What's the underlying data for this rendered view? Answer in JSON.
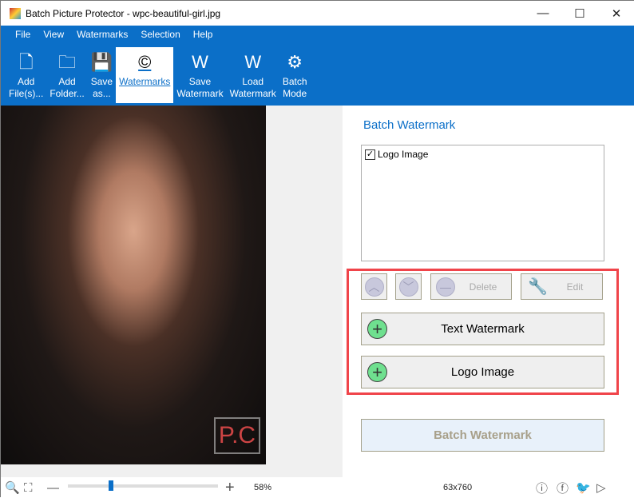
{
  "window": {
    "title": "Batch Picture Protector - wpc-beautiful-girl.jpg",
    "minimize": "—",
    "maximize": "☐",
    "close": "✕"
  },
  "menu": [
    "File",
    "View",
    "Watermarks",
    "Selection",
    "Help"
  ],
  "toolbar": [
    {
      "label1": "Add",
      "label2": "File(s)...",
      "icon": "file-plus-icon",
      "glyph": "🗋"
    },
    {
      "label1": "Add",
      "label2": "Folder...",
      "icon": "folder-plus-icon",
      "glyph": "🗀"
    },
    {
      "label1": "Save",
      "label2": "as...",
      "icon": "save-icon",
      "glyph": "💾"
    },
    {
      "label1": "Watermarks",
      "label2": "",
      "icon": "copyright-icon",
      "glyph": "©",
      "active": true
    },
    {
      "label1": "Save",
      "label2": "Watermark",
      "icon": "save-watermark-icon",
      "glyph": "W"
    },
    {
      "label1": "Load",
      "label2": "Watermark",
      "icon": "load-watermark-icon",
      "glyph": "W"
    },
    {
      "label1": "Batch",
      "label2": "Mode",
      "icon": "gear-icon",
      "glyph": "⚙"
    }
  ],
  "panel": {
    "title": "Batch Watermark",
    "list": [
      {
        "label": "Logo Image",
        "checked": true
      }
    ],
    "delete": "Delete",
    "edit": "Edit",
    "text_watermark": "Text Watermark",
    "logo_image": "Logo Image",
    "batch_watermark": "Batch Watermark"
  },
  "status": {
    "zoom": "58%",
    "zoom_fraction": 0.28,
    "dimensions": "63x760"
  },
  "colors": {
    "accent": "#0b6fc8",
    "highlight": "#f0444a",
    "add": "#6fe08f"
  }
}
